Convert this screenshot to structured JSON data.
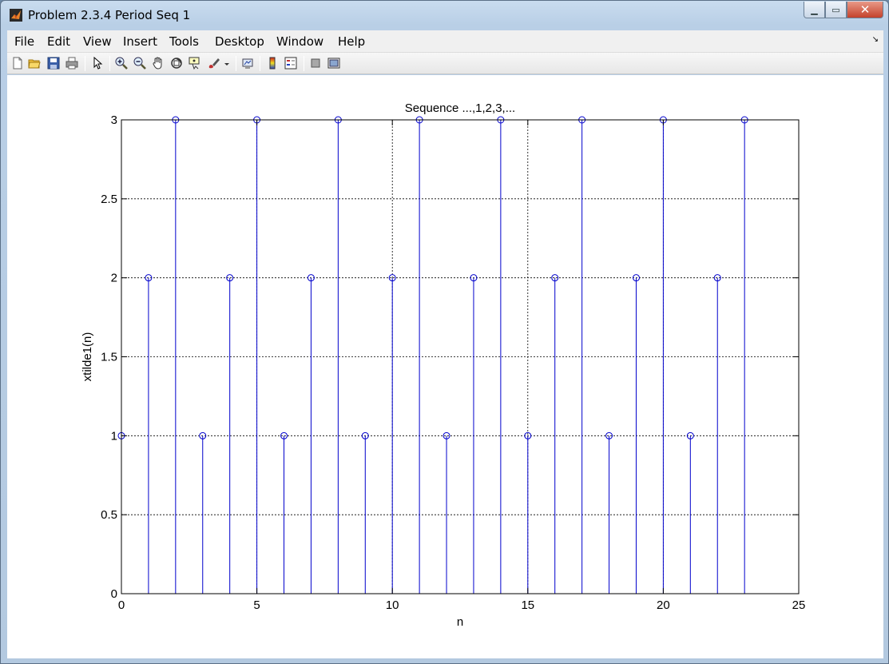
{
  "window": {
    "title": "Problem 2.3.4 Period Seq 1",
    "minimize_glyph": "▁",
    "maximize_glyph": "▭",
    "close_glyph": "✕"
  },
  "menu": {
    "items": [
      "File",
      "Edit",
      "View",
      "Insert",
      "Tools",
      "Desktop",
      "Window",
      "Help"
    ],
    "overflow_glyph": "↘"
  },
  "toolbar": {
    "icons": [
      "new-figure-icon",
      "open-file-icon",
      "save-icon",
      "print-icon",
      "edit-plot-arrow-icon",
      "zoom-in-icon",
      "zoom-out-icon",
      "pan-hand-icon",
      "rotate-3d-icon",
      "data-cursor-icon",
      "brush-icon",
      "link-plot-icon",
      "colorbar-icon",
      "legend-icon",
      "hide-plot-tools-icon",
      "show-plot-tools-icon"
    ]
  },
  "chart_data": {
    "type": "stem",
    "title": "Sequence ...,1,2,3,...",
    "xlabel": "n",
    "ylabel": "xtilde1(n)",
    "xlim": [
      0,
      25
    ],
    "ylim": [
      0,
      3
    ],
    "xticks": [
      0,
      5,
      10,
      15,
      20,
      25
    ],
    "yticks": [
      0,
      0.5,
      1,
      1.5,
      2,
      2.5,
      3
    ],
    "grid": true,
    "marker": "circle",
    "color": "#0000cc",
    "x": [
      0,
      1,
      2,
      3,
      4,
      5,
      6,
      7,
      8,
      9,
      10,
      11,
      12,
      13,
      14,
      15,
      16,
      17,
      18,
      19,
      20,
      21,
      22,
      23
    ],
    "y": [
      1,
      2,
      3,
      1,
      2,
      3,
      1,
      2,
      3,
      1,
      2,
      3,
      1,
      2,
      3,
      1,
      2,
      3,
      1,
      2,
      3,
      1,
      2,
      3
    ]
  }
}
